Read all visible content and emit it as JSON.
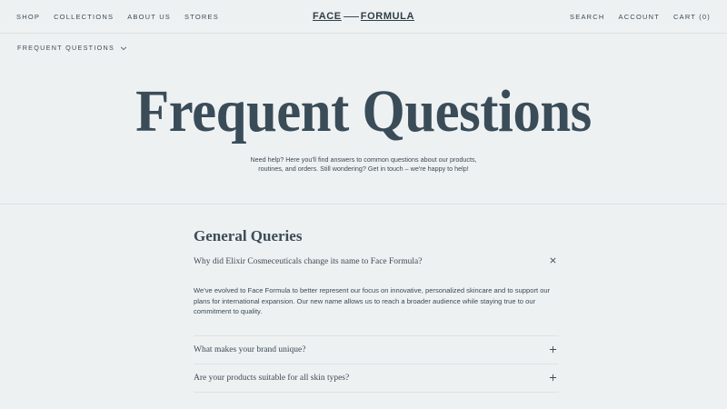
{
  "header": {
    "nav_left": [
      "SHOP",
      "COLLECTIONS",
      "ABOUT US",
      "STORES"
    ],
    "logo_left": "FACE",
    "logo_right": "FORMULA",
    "nav_right": [
      "SEARCH",
      "ACCOUNT",
      "CART (0)"
    ]
  },
  "subnav": {
    "label": "FREQUENT QUESTIONS"
  },
  "hero": {
    "title": "Frequent Questions",
    "subtitle": "Need help? Here you'll find answers to common questions about our products, routines, and orders. Still wondering? Get in touch – we're happy to help!"
  },
  "faq": {
    "section_title": "General Queries",
    "items": [
      {
        "question": "Why did Elixir Cosmeceuticals change its name to Face Formula?",
        "answer": "We've evolved to Face Formula to better represent our focus on innovative, personalized skincare and to support our plans for international expansion. Our new name allows us to reach a broader audience while staying true to our commitment to quality."
      },
      {
        "question": "What makes your brand unique?"
      },
      {
        "question": "Are your products suitable for all skin types?"
      }
    ]
  },
  "icons": {
    "close": "close-icon",
    "plus": "plus-icon",
    "chevron": "chevron-down-icon"
  }
}
